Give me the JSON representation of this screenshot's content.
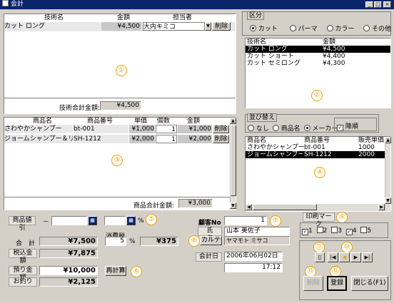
{
  "window": {
    "title": "会計",
    "minimize": "_",
    "restore": "□",
    "close": "×"
  },
  "tech": {
    "headers": [
      "技術名",
      "金額",
      "担当者"
    ],
    "rows": [
      {
        "name": "カット ロング",
        "amount": "¥4,500",
        "staff": "大内キミコ",
        "delete": "削除"
      }
    ],
    "total_label": "技術合計金額:",
    "total": "¥4,500",
    "marker": "①"
  },
  "category": {
    "legend": "区分",
    "options": [
      "カット",
      "パーマ",
      "カラー",
      "その他"
    ],
    "selected": "カット",
    "list_headers": [
      "技術名",
      "金額"
    ],
    "list": [
      {
        "name": "カット ロング",
        "amount": "¥4,500"
      },
      {
        "name": "カット ショート",
        "amount": "¥4,400"
      },
      {
        "name": "カット セミロング",
        "amount": "¥4,300"
      }
    ],
    "marker": "②"
  },
  "products": {
    "headers": [
      "商品名",
      "商品番号",
      "単価",
      "個数",
      "金額"
    ],
    "rows": [
      {
        "name": "さわやかシャンプー",
        "code": "bt-001",
        "price": "¥1,000",
        "qty": "1",
        "amount": "¥1,000",
        "delete": "削除"
      },
      {
        "name": "ジョームシャンプー＆リンス",
        "code": "SH-1212",
        "price": "¥2,000",
        "qty": "1",
        "amount": "¥2,000",
        "delete": "削除"
      }
    ],
    "total_label": "商品合計金額:",
    "total": "¥3,000",
    "marker": "③"
  },
  "sort": {
    "legend": "並び替え",
    "options": [
      "なし",
      "商品名",
      "メーカー"
    ],
    "selected": "メーカー",
    "desc_label": "降順",
    "list_headers": [
      "商品名",
      "商品番号",
      "販売単価"
    ],
    "list": [
      {
        "name": "さわやかシャンプー",
        "code": "bt-001",
        "price": "1000"
      },
      {
        "name": "ジョームシャンプー＆",
        "code": "SH-1212",
        "price": "2000"
      }
    ],
    "marker": "④"
  },
  "discount": {
    "label": "商品値引",
    "dash": "－",
    "percent": "%",
    "marker": "⑤"
  },
  "totals": {
    "total_label": "合　計",
    "total": "¥7,500",
    "tax_label": "消費税",
    "tax_rate": "5",
    "tax_percent": "%",
    "tax": "¥375",
    "incl_label": "税込金額",
    "incl": "¥7,875",
    "deposit_label": "預り金額",
    "deposit": "¥10,000",
    "recalc": "再計算",
    "change_label": "お釣り",
    "change": "¥2,125",
    "marker": "⑥"
  },
  "customer": {
    "no_label": "顧客No",
    "no": "1",
    "marker7": "⑦",
    "name_label": "氏　名",
    "name": "山本 美佐子",
    "karte": "カルテ",
    "kana": "ヤマモト ミサコ",
    "marker8": "⑧",
    "date_label": "会計日",
    "date": "2006年06月02日",
    "time": "17:12"
  },
  "print": {
    "label": "印刷マーク",
    "marker": "⑨",
    "items": [
      {
        "n": "1",
        "checked": true
      },
      {
        "n": "2",
        "checked": false
      },
      {
        "n": "3",
        "checked": false
      },
      {
        "n": "4",
        "checked": true
      },
      {
        "n": "5",
        "checked": false
      }
    ]
  },
  "nav": {
    "marker11": "⑪",
    "marker10": "⑩",
    "marker13": "⑬",
    "marker12": "⑫",
    "delete": "削除",
    "register": "登録",
    "close": "閉じる(F1)",
    "first": "|◀",
    "prev": "◀",
    "next": "▶",
    "last": "▶|"
  }
}
